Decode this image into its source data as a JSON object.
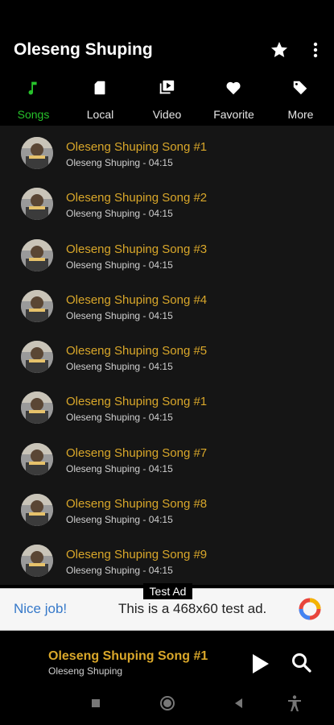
{
  "app": {
    "title": "Oleseng Shuping"
  },
  "tabs": [
    {
      "label": "Songs",
      "icon": "music-note-icon",
      "active": true
    },
    {
      "label": "Local",
      "icon": "sd-card-icon"
    },
    {
      "label": "Video",
      "icon": "video-library-icon"
    },
    {
      "label": "Favorite",
      "icon": "heart-icon"
    },
    {
      "label": "More",
      "icon": "tag-icon"
    }
  ],
  "songs": [
    {
      "title": "Oleseng Shuping Song #1",
      "subtitle": "Oleseng Shuping - 04:15"
    },
    {
      "title": "Oleseng Shuping Song #2",
      "subtitle": "Oleseng Shuping - 04:15"
    },
    {
      "title": "Oleseng Shuping Song #3",
      "subtitle": "Oleseng Shuping - 04:15"
    },
    {
      "title": "Oleseng Shuping Song #4",
      "subtitle": "Oleseng Shuping - 04:15"
    },
    {
      "title": "Oleseng Shuping Song #5",
      "subtitle": "Oleseng Shuping - 04:15"
    },
    {
      "title": "Oleseng Shuping Song #1",
      "subtitle": "Oleseng Shuping - 04:15"
    },
    {
      "title": "Oleseng Shuping Song #7",
      "subtitle": "Oleseng Shuping - 04:15"
    },
    {
      "title": "Oleseng Shuping Song #8",
      "subtitle": "Oleseng Shuping - 04:15"
    },
    {
      "title": "Oleseng Shuping Song #9",
      "subtitle": "Oleseng Shuping - 04:15"
    }
  ],
  "ad": {
    "label": "Test Ad",
    "nice": "Nice job!",
    "text": "This is a 468x60 test ad."
  },
  "player": {
    "title": "Oleseng Shuping Song #1",
    "artist": "Oleseng Shuping"
  },
  "colors": {
    "accent_green": "#27c22b",
    "song_title": "#d9a72a",
    "list_bg": "#151515"
  }
}
